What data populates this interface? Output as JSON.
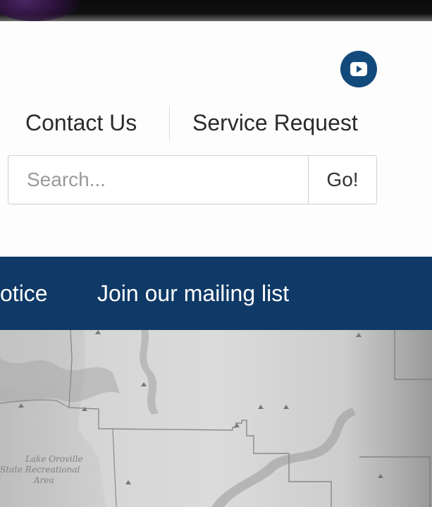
{
  "social": {
    "youtube_icon": "youtube-icon",
    "brand_color": "#134a7c"
  },
  "top_links": {
    "contact": "Contact Us",
    "service": "Service Request"
  },
  "search": {
    "placeholder": "Search...",
    "button_label": "Go!"
  },
  "nav": {
    "background": "#0f3966",
    "items": [
      {
        "label": "otice"
      },
      {
        "label": "Join our mailing list"
      }
    ]
  },
  "map": {
    "labels": [
      "Lake Oroville",
      "State Recreational",
      "Area"
    ]
  }
}
